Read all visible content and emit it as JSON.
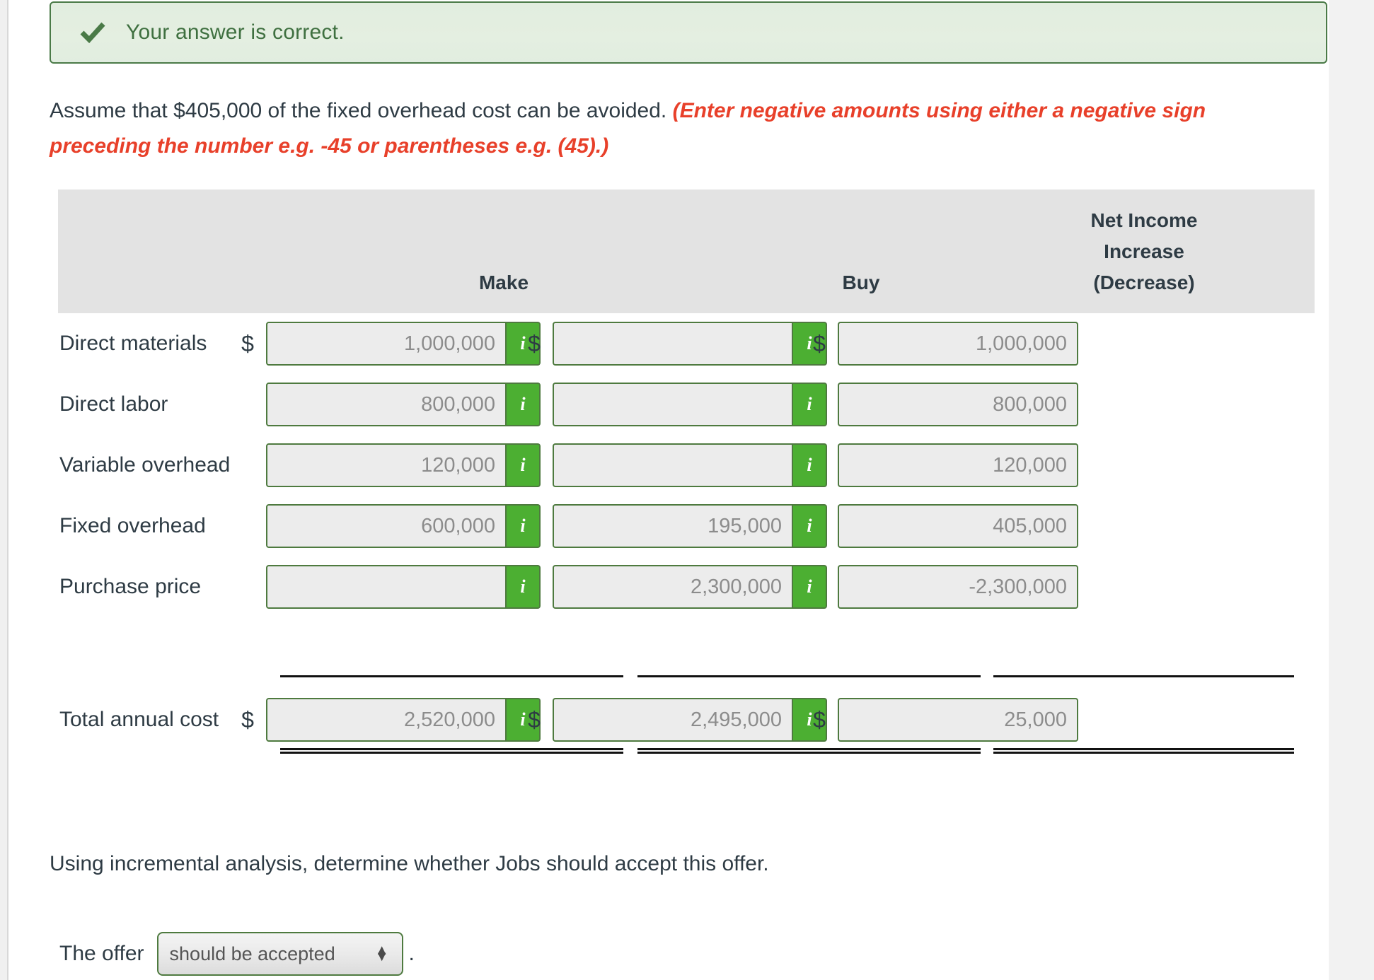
{
  "alert": {
    "icon": "check-icon",
    "message": "Your answer is correct."
  },
  "prompt": {
    "lead": "Assume that $405,000 of the fixed overhead cost can be avoided. ",
    "hint": "(Enter negative amounts using either a negative sign preceding the number e.g. -45 or parentheses e.g. (45).)"
  },
  "table": {
    "headers": {
      "label": "",
      "make": "Make",
      "buy": "Buy",
      "net_income_line1": "Net Income",
      "net_income_line2": "Increase",
      "net_income_line3": "(Decrease)"
    },
    "currency_symbol": "$",
    "info_icon": "i",
    "rows": [
      {
        "label": "Direct materials",
        "make": {
          "value": "1,000,000",
          "dollar": true,
          "info": true
        },
        "buy": {
          "value": "",
          "dollar": true,
          "info": true
        },
        "net": {
          "value": "1,000,000",
          "dollar": true,
          "info": false
        }
      },
      {
        "label": "Direct labor",
        "make": {
          "value": "800,000",
          "dollar": false,
          "info": true
        },
        "buy": {
          "value": "",
          "dollar": false,
          "info": true
        },
        "net": {
          "value": "800,000",
          "dollar": false,
          "info": false
        }
      },
      {
        "label": "Variable overhead",
        "make": {
          "value": "120,000",
          "dollar": false,
          "info": true
        },
        "buy": {
          "value": "",
          "dollar": false,
          "info": true
        },
        "net": {
          "value": "120,000",
          "dollar": false,
          "info": false
        }
      },
      {
        "label": "Fixed overhead",
        "make": {
          "value": "600,000",
          "dollar": false,
          "info": true
        },
        "buy": {
          "value": "195,000",
          "dollar": false,
          "info": true
        },
        "net": {
          "value": "405,000",
          "dollar": false,
          "info": false
        }
      },
      {
        "label": "Purchase price",
        "make": {
          "value": "",
          "dollar": false,
          "info": true
        },
        "buy": {
          "value": "2,300,000",
          "dollar": false,
          "info": true
        },
        "net": {
          "value": "-2,300,000",
          "dollar": false,
          "info": false
        }
      },
      {
        "label": "Total annual cost",
        "make": {
          "value": "2,520,000",
          "dollar": true,
          "info": true
        },
        "buy": {
          "value": "2,495,000",
          "dollar": true,
          "info": true
        },
        "net": {
          "value": "25,000",
          "dollar": true,
          "info": false
        }
      }
    ]
  },
  "footer": {
    "question": "Using incremental analysis, determine whether Jobs should accept this offer.",
    "offer_label": "The offer",
    "offer_value": "should be accepted",
    "offer_options": [
      "should be accepted"
    ],
    "period": "."
  },
  "colors": {
    "accent_green": "#4caf32",
    "border_green": "#4e7a3f",
    "alert_green_text": "#3f7040",
    "alert_bg": "#e3eee0",
    "hint_red": "#e8402a",
    "header_gray": "#e3e3e3",
    "text_dark": "#2e3b44",
    "input_bg": "#ececec",
    "input_text": "#8c8c8c"
  }
}
